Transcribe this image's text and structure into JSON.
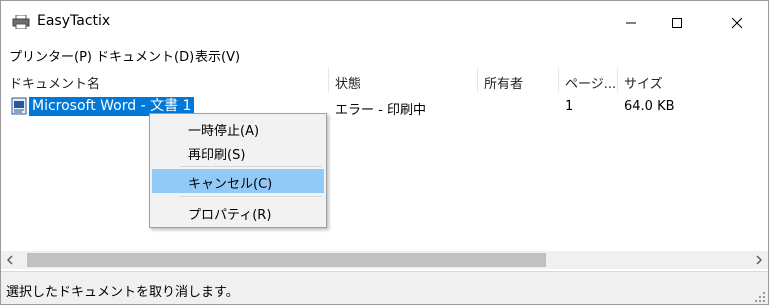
{
  "window": {
    "title": "EasyTactix"
  },
  "menubar": {
    "items": [
      "プリンター(P)",
      "ドキュメント(D)",
      "表示(V)"
    ]
  },
  "list": {
    "columns": [
      "ドキュメント名",
      "状態",
      "所有者",
      "ページ...",
      "サイズ"
    ],
    "rows": [
      {
        "name": "Microsoft Word - 文書 1",
        "status": "エラー - 印刷中",
        "owner": "",
        "pages": "1",
        "size": "64.0 KB"
      }
    ]
  },
  "context_menu": {
    "items": [
      "一時停止(A)",
      "再印刷(S)",
      "キャンセル(C)",
      "プロパティ(R)"
    ],
    "highlighted": "キャンセル(C)"
  },
  "statusbar": {
    "text": "選択したドキュメントを取り消します。"
  },
  "colors": {
    "selection": "#0078d7",
    "menu_highlight": "#91c9f7"
  },
  "icons": [
    "printer-icon",
    "minimize-icon",
    "maximize-icon",
    "close-icon",
    "word-document-icon",
    "scroll-left-icon",
    "scroll-right-icon",
    "size-grip-icon"
  ]
}
